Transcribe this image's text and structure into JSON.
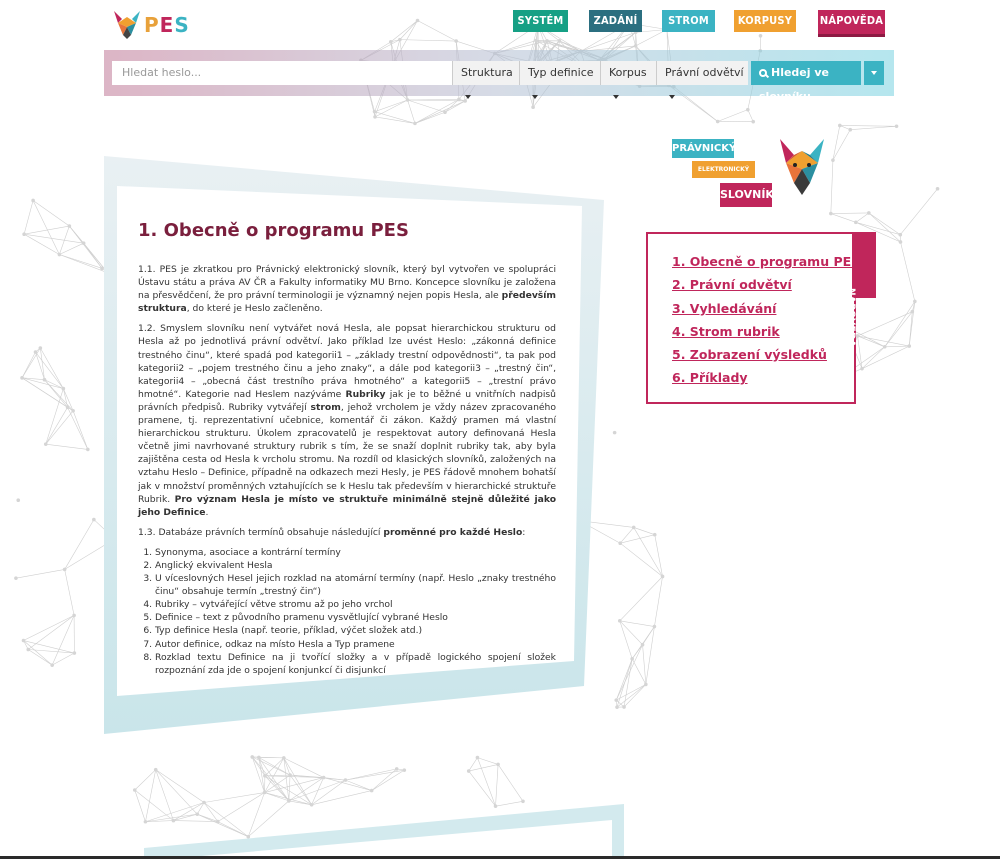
{
  "logo": {
    "text_p": "P",
    "text_e": "E",
    "text_s": "S"
  },
  "nav": [
    {
      "id": "system",
      "label": "SYSTÉM"
    },
    {
      "id": "zadani",
      "label": "ZADÁNÍ"
    },
    {
      "id": "strom",
      "label": "STROM"
    },
    {
      "id": "korpusy",
      "label": "KORPUSY"
    },
    {
      "id": "napoveda",
      "label": "NÁPOVĚDA"
    }
  ],
  "search": {
    "placeholder": "Hledat heslo...",
    "filters": [
      "Struktura",
      "Typ definice",
      "Korpus",
      "Právní odvětví"
    ],
    "button_label": "Hledej ve slovníku"
  },
  "brand": {
    "line1": "PRÁVNICKÝ",
    "line2": "ELEKTRONICKÝ",
    "line3": "SLOVNÍK"
  },
  "page": {
    "title": "1. Obecně o programu PES",
    "p1": "1.1. PES je zkratkou pro Právnický elektronický slovník, který byl vytvořen ve spolupráci Ústavu státu a práva AV ČR a Fakulty informatiky MU Brno. Koncepce slovníku je založena na přesvědčení, že pro právní terminologii je významný nejen popis Hesla, ale ",
    "p1_bold": "především struktura",
    "p1_end": ", do které je Heslo začleněno.",
    "p2a": "1.2. Smyslem slovníku není vytvářet nová Hesla, ale popsat hierarchickou strukturu od Hesla až po jednotlivá právní odvětví. Jako příklad lze uvést Heslo: „zákonná definice trestného činu“, které spadá pod kategorii1 – „základy trestní odpovědnosti“, ta pak pod kategorii2 – „pojem trestného činu a jeho znaky“, a dále pod kategorii3 – „trestný čin“, kategorii4 – „obecná část trestního práva hmotného“ a kategorii5 – „trestní právo hmotné“. Kategorie nad Heslem nazýváme ",
    "p2_bold1": "Rubriky",
    "p2b": " jak je to běžné u vnitřních nadpisů právních předpisů. Rubriky vytvářejí ",
    "p2_bold2": "strom",
    "p2c": ", jehož vrcholem je vždy název zpracovaného pramene, tj. reprezentativní učebnice, komentář či zákon. Každý pramen má vlastní hierarchickou strukturu. Úkolem zpracovatelů je respektovat autory definovaná Hesla včetně jimi navrhované struktury rubrik s tím, že se snaží doplnit rubriky tak, aby byla zajištěna cesta od Hesla k vrcholu stromu. Na rozdíl od klasických slovníků, založených na vztahu Heslo – Definice, případně na odkazech mezi Hesly, je PES řádově mnohem bohatší jak v množství proměnných vztahujících se k Heslu tak především v hierarchické struktuře Rubrik. ",
    "p2_bold3": "Pro význam Hesla je místo ve struktuře minimálně stejně důležité jako jeho Definice",
    "p2d": ".",
    "p3a": "1.3. Databáze právních termínů obsahuje následující ",
    "p3_bold": "proměnné pro každé Heslo",
    "p3b": ":",
    "list": [
      "Synonyma, asociace a kontrární termíny",
      "Anglický ekvivalent Hesla",
      "U víceslovných Hesel jejich rozklad na atomární termíny (např. Heslo „znaky trestného činu“ obsahuje termín „trestný čin“)",
      "Rubriky – vytvářející větve stromu až po jeho vrchol",
      "Definice – text z původního pramenu vysvětlující vybrané Heslo",
      "Typ definice Hesla (např. teorie, příklad, výčet složek atd.)",
      "Autor definice, odkaz na místo Hesla a Typ pramene",
      "Rozklad textu Definice na ji tvořící složky a v případě logického spojení složek rozpoznání zda jde o spojení konjunkcí či disjunkcí"
    ]
  },
  "toc": {
    "tab_label": "NÁPOVĚDA",
    "items": [
      "1. Obecně o programu PES",
      "2. Právní odvětví",
      "3. Vyhledávání",
      "4. Strom rubrik",
      "5. Zobrazení výsledků",
      "6. Příklady"
    ]
  },
  "colors": {
    "crimson": "#c0265b",
    "teal": "#3bb3c3",
    "green": "#16a085",
    "dark_teal": "#2b6f80",
    "orange": "#f0a030",
    "title": "#7a1f3d"
  }
}
